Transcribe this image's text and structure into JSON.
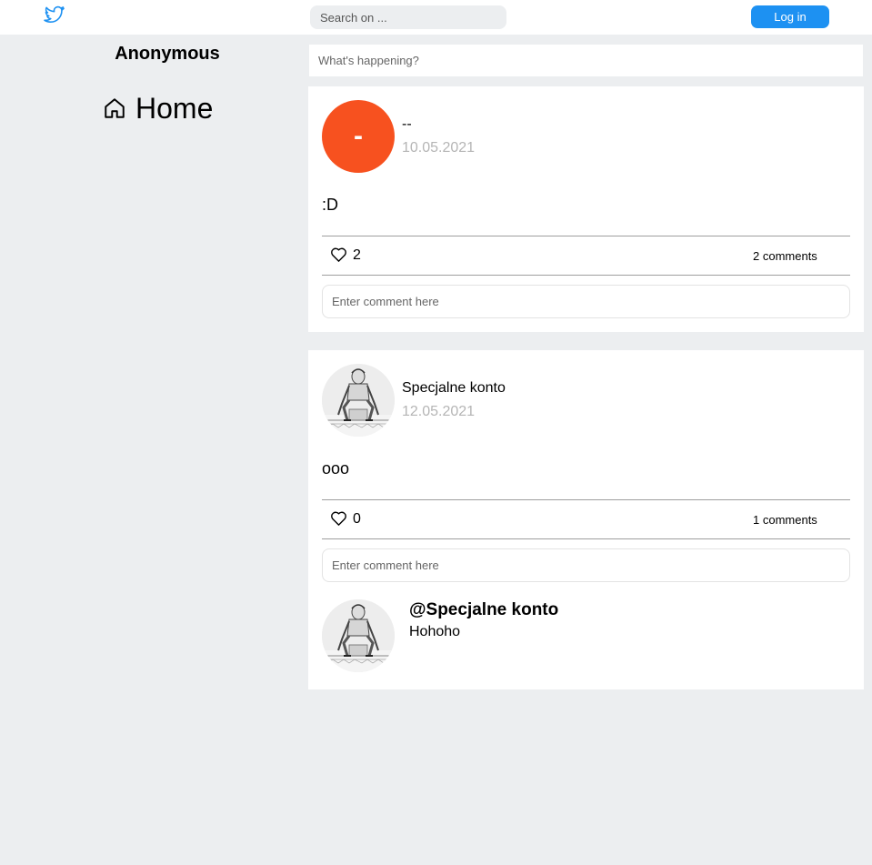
{
  "header": {
    "logo_icon": "twitter-bird-icon",
    "search_placeholder": "Search on ...",
    "login_label": "Log in",
    "accent_color": "#1d91f2"
  },
  "sidebar": {
    "user_name": "Anonymous",
    "home_icon": "home-icon",
    "home_label": "Home"
  },
  "compose": {
    "placeholder": "What's happening?"
  },
  "posts": [
    {
      "avatar_letter": "-",
      "avatar_color": "#f7511f",
      "author": "--",
      "date": "10.05.2021",
      "content": ":D",
      "likes": "2",
      "comments_label": "2 comments",
      "comment_placeholder": "Enter comment here"
    },
    {
      "avatar_icon": "sketch-avatar-icon",
      "author": "Specjalne konto",
      "date": "12.05.2021",
      "content": "ooo",
      "likes": "0",
      "comments_label": "1 comments",
      "comment_placeholder": "Enter comment here",
      "comments": [
        {
          "author": "@Specjalne konto",
          "text": "Hohoho"
        }
      ]
    }
  ]
}
